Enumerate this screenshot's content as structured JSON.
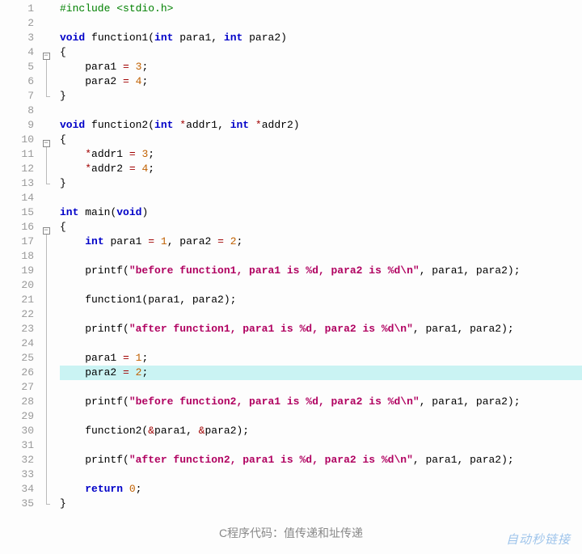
{
  "caption": "C程序代码：值传递和址传递",
  "watermark": "自动秒链接",
  "fold_minus": "−",
  "lines": [
    {
      "n": 1,
      "fold": "",
      "tokens": [
        [
          "inc",
          "#include <stdio.h>"
        ]
      ]
    },
    {
      "n": 2,
      "fold": "",
      "tokens": []
    },
    {
      "n": 3,
      "fold": "",
      "tokens": [
        [
          "kw",
          "void "
        ],
        [
          "fn",
          "function1"
        ],
        [
          "pun",
          "("
        ],
        [
          "kw",
          "int "
        ],
        [
          "fn",
          "para1"
        ],
        [
          "pun",
          ", "
        ],
        [
          "kw",
          "int "
        ],
        [
          "fn",
          "para2"
        ],
        [
          "pun",
          ")"
        ]
      ]
    },
    {
      "n": 4,
      "fold": "minus",
      "tokens": [
        [
          "pun",
          "{"
        ]
      ]
    },
    {
      "n": 5,
      "fold": "vline",
      "tokens": [
        [
          "fn",
          "    para1 "
        ],
        [
          "op",
          "="
        ],
        [
          "fn",
          " "
        ],
        [
          "num",
          "3"
        ],
        [
          "pun",
          ";"
        ]
      ]
    },
    {
      "n": 6,
      "fold": "vline",
      "tokens": [
        [
          "fn",
          "    para2 "
        ],
        [
          "op",
          "="
        ],
        [
          "fn",
          " "
        ],
        [
          "num",
          "4"
        ],
        [
          "pun",
          ";"
        ]
      ]
    },
    {
      "n": 7,
      "fold": "corner",
      "tokens": [
        [
          "pun",
          "}"
        ]
      ]
    },
    {
      "n": 8,
      "fold": "",
      "tokens": []
    },
    {
      "n": 9,
      "fold": "",
      "tokens": [
        [
          "kw",
          "void "
        ],
        [
          "fn",
          "function2"
        ],
        [
          "pun",
          "("
        ],
        [
          "kw",
          "int "
        ],
        [
          "op",
          "*"
        ],
        [
          "fn",
          "addr1"
        ],
        [
          "pun",
          ", "
        ],
        [
          "kw",
          "int "
        ],
        [
          "op",
          "*"
        ],
        [
          "fn",
          "addr2"
        ],
        [
          "pun",
          ")"
        ]
      ]
    },
    {
      "n": 10,
      "fold": "minus",
      "tokens": [
        [
          "pun",
          "{"
        ]
      ]
    },
    {
      "n": 11,
      "fold": "vline",
      "tokens": [
        [
          "fn",
          "    "
        ],
        [
          "op",
          "*"
        ],
        [
          "fn",
          "addr1 "
        ],
        [
          "op",
          "="
        ],
        [
          "fn",
          " "
        ],
        [
          "num",
          "3"
        ],
        [
          "pun",
          ";"
        ]
      ]
    },
    {
      "n": 12,
      "fold": "vline",
      "tokens": [
        [
          "fn",
          "    "
        ],
        [
          "op",
          "*"
        ],
        [
          "fn",
          "addr2 "
        ],
        [
          "op",
          "="
        ],
        [
          "fn",
          " "
        ],
        [
          "num",
          "4"
        ],
        [
          "pun",
          ";"
        ]
      ]
    },
    {
      "n": 13,
      "fold": "corner",
      "tokens": [
        [
          "pun",
          "}"
        ]
      ]
    },
    {
      "n": 14,
      "fold": "",
      "tokens": []
    },
    {
      "n": 15,
      "fold": "",
      "tokens": [
        [
          "kw",
          "int "
        ],
        [
          "fn",
          "main"
        ],
        [
          "pun",
          "("
        ],
        [
          "kw",
          "void"
        ],
        [
          "pun",
          ")"
        ]
      ]
    },
    {
      "n": 16,
      "fold": "minus",
      "tokens": [
        [
          "pun",
          "{"
        ]
      ]
    },
    {
      "n": 17,
      "fold": "vline",
      "tokens": [
        [
          "fn",
          "    "
        ],
        [
          "kw",
          "int "
        ],
        [
          "fn",
          "para1 "
        ],
        [
          "op",
          "="
        ],
        [
          "fn",
          " "
        ],
        [
          "num",
          "1"
        ],
        [
          "pun",
          ", "
        ],
        [
          "fn",
          "para2 "
        ],
        [
          "op",
          "="
        ],
        [
          "fn",
          " "
        ],
        [
          "num",
          "2"
        ],
        [
          "pun",
          ";"
        ]
      ]
    },
    {
      "n": 18,
      "fold": "vline",
      "tokens": []
    },
    {
      "n": 19,
      "fold": "vline",
      "tokens": [
        [
          "fn",
          "    printf"
        ],
        [
          "pun",
          "("
        ],
        [
          "str",
          "\"before function1, para1 is %d, para2 is %d\\n\""
        ],
        [
          "pun",
          ", para1, para2);"
        ]
      ]
    },
    {
      "n": 20,
      "fold": "vline",
      "tokens": []
    },
    {
      "n": 21,
      "fold": "vline",
      "tokens": [
        [
          "fn",
          "    function1"
        ],
        [
          "pun",
          "(para1, para2);"
        ]
      ]
    },
    {
      "n": 22,
      "fold": "vline",
      "tokens": []
    },
    {
      "n": 23,
      "fold": "vline",
      "tokens": [
        [
          "fn",
          "    printf"
        ],
        [
          "pun",
          "("
        ],
        [
          "str",
          "\"after function1, para1 is %d, para2 is %d\\n\""
        ],
        [
          "pun",
          ", para1, para2);"
        ]
      ]
    },
    {
      "n": 24,
      "fold": "vline",
      "tokens": []
    },
    {
      "n": 25,
      "fold": "vline",
      "tokens": [
        [
          "fn",
          "    para1 "
        ],
        [
          "op",
          "="
        ],
        [
          "fn",
          " "
        ],
        [
          "num",
          "1"
        ],
        [
          "pun",
          ";"
        ]
      ]
    },
    {
      "n": 26,
      "fold": "vline",
      "hl": true,
      "tokens": [
        [
          "fn",
          "    para2 "
        ],
        [
          "op",
          "="
        ],
        [
          "fn",
          " "
        ],
        [
          "num",
          "2"
        ],
        [
          "pun",
          ";"
        ]
      ]
    },
    {
      "n": 27,
      "fold": "vline",
      "tokens": []
    },
    {
      "n": 28,
      "fold": "vline",
      "tokens": [
        [
          "fn",
          "    printf"
        ],
        [
          "pun",
          "("
        ],
        [
          "str",
          "\"before function2, para1 is %d, para2 is %d\\n\""
        ],
        [
          "pun",
          ", para1, para2);"
        ]
      ]
    },
    {
      "n": 29,
      "fold": "vline",
      "tokens": []
    },
    {
      "n": 30,
      "fold": "vline",
      "tokens": [
        [
          "fn",
          "    function2"
        ],
        [
          "pun",
          "("
        ],
        [
          "op",
          "&"
        ],
        [
          "fn",
          "para1"
        ],
        [
          "pun",
          ", "
        ],
        [
          "op",
          "&"
        ],
        [
          "fn",
          "para2"
        ],
        [
          "pun",
          ");"
        ]
      ]
    },
    {
      "n": 31,
      "fold": "vline",
      "tokens": []
    },
    {
      "n": 32,
      "fold": "vline",
      "tokens": [
        [
          "fn",
          "    printf"
        ],
        [
          "pun",
          "("
        ],
        [
          "str",
          "\"after function2, para1 is %d, para2 is %d\\n\""
        ],
        [
          "pun",
          ", para1, para2);"
        ]
      ]
    },
    {
      "n": 33,
      "fold": "vline",
      "tokens": []
    },
    {
      "n": 34,
      "fold": "vline",
      "tokens": [
        [
          "fn",
          "    "
        ],
        [
          "kw",
          "return "
        ],
        [
          "num",
          "0"
        ],
        [
          "pun",
          ";"
        ]
      ]
    },
    {
      "n": 35,
      "fold": "corner",
      "tokens": [
        [
          "pun",
          "}"
        ]
      ]
    }
  ]
}
